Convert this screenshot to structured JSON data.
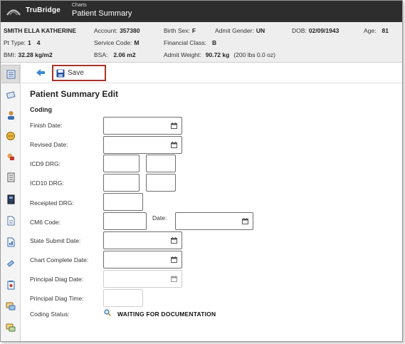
{
  "app": {
    "brand": "TruBridge",
    "breadcrumb": "Charts",
    "page_title": "Patient Summary"
  },
  "patient": {
    "name": "SMITH ELLA KATHERINE",
    "account_label": "Account:",
    "account": "357380",
    "birth_sex_label": "Birth Sex:",
    "birth_sex": "F",
    "admit_gender_label": "Admit Gender:",
    "admit_gender": "UN",
    "dob_label": "DOB:",
    "dob": "02/09/1943",
    "age_label": "Age:",
    "age": "81",
    "pt_type_label": "Pt Type:",
    "pt_type": "1",
    "pt_type_2": "4",
    "service_code_label": "Service Code:",
    "service_code": "M",
    "financial_class_label": "Financial Class:",
    "financial_class": "B",
    "bmi_label": "BMI:",
    "bmi": "32.28 kg/m2",
    "bsa_label": "BSA:",
    "bsa": "2.06 m2",
    "admit_weight_label": "Admit Weight:",
    "admit_weight": "90.72 kg",
    "admit_weight_alt": "(200 lbs 0.0 oz)"
  },
  "toolbar": {
    "save_label": "Save"
  },
  "form": {
    "title": "Patient Summary Edit",
    "section": "Coding",
    "finish_date_label": "Finish Date:",
    "revised_date_label": "Revised Date:",
    "icd9_drg_label": "ICD9 DRG:",
    "icd10_drg_label": "ICD10 DRG:",
    "receipted_drg_label": "Receipted DRG:",
    "cm6_code_label": "CM6 Code:",
    "date_label": "Date:",
    "state_submit_date_label": "State Submit Date:",
    "chart_complete_date_label": "Chart Complete Date:",
    "principal_diag_date_label": "Principal Diag Date:",
    "principal_diag_time_label": "Principal Diag Time:",
    "coding_status_label": "Coding Status:",
    "coding_status_value": "WAITING FOR DOCUMENTATION"
  },
  "colors": {
    "topbar": "#2d2d2d",
    "save_border": "#a8322a",
    "save_icon": "#1f4e9b"
  }
}
